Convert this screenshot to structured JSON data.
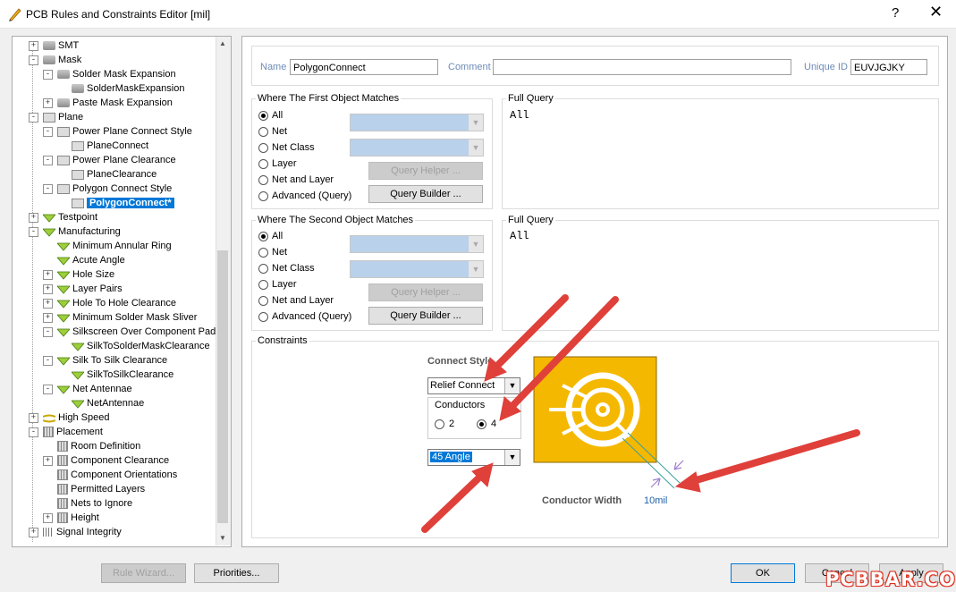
{
  "window": {
    "title": "PCB Rules and Constraints Editor [mil]",
    "help_label": "?",
    "close_label": "✕"
  },
  "tree": {
    "items": [
      {
        "label": "SMT",
        "level": 0,
        "exp": "+",
        "icon": "gray-rule-icon"
      },
      {
        "label": "Mask",
        "level": 0,
        "exp": "−",
        "icon": "gray-rule-icon"
      },
      {
        "label": "Solder Mask Expansion",
        "level": 1,
        "exp": "−",
        "icon": "gray-rule-icon"
      },
      {
        "label": "SolderMaskExpansion",
        "level": 2,
        "exp": "",
        "icon": "gray-rule-icon"
      },
      {
        "label": "Paste Mask Expansion",
        "level": 1,
        "exp": "+",
        "icon": "gray-rule-icon"
      },
      {
        "label": "Plane",
        "level": 0,
        "exp": "−",
        "icon": "plane-icon"
      },
      {
        "label": "Power Plane Connect Style",
        "level": 1,
        "exp": "−",
        "icon": "plane-icon"
      },
      {
        "label": "PlaneConnect",
        "level": 2,
        "exp": "",
        "icon": "plane-icon"
      },
      {
        "label": "Power Plane Clearance",
        "level": 1,
        "exp": "−",
        "icon": "plane-icon"
      },
      {
        "label": "PlaneClearance",
        "level": 2,
        "exp": "",
        "icon": "plane-icon"
      },
      {
        "label": "Polygon Connect Style",
        "level": 1,
        "exp": "−",
        "icon": "plane-icon"
      },
      {
        "label": "PolygonConnect*",
        "level": 2,
        "exp": "",
        "icon": "plane-icon",
        "selected": true
      },
      {
        "label": "Testpoint",
        "level": 0,
        "exp": "+",
        "icon": "testpoint-icon"
      },
      {
        "label": "Manufacturing",
        "level": 0,
        "exp": "−",
        "icon": "rule-icon"
      },
      {
        "label": "Minimum Annular Ring",
        "level": 1,
        "exp": "",
        "icon": "rule-icon"
      },
      {
        "label": "Acute Angle",
        "level": 1,
        "exp": "",
        "icon": "rule-icon"
      },
      {
        "label": "Hole Size",
        "level": 1,
        "exp": "+",
        "icon": "rule-icon"
      },
      {
        "label": "Layer Pairs",
        "level": 1,
        "exp": "+",
        "icon": "rule-icon"
      },
      {
        "label": "Hole To Hole Clearance",
        "level": 1,
        "exp": "+",
        "icon": "rule-icon"
      },
      {
        "label": "Minimum Solder Mask Sliver",
        "level": 1,
        "exp": "+",
        "icon": "rule-icon"
      },
      {
        "label": "Silkscreen Over Component Pads",
        "level": 1,
        "exp": "−",
        "icon": "rule-icon"
      },
      {
        "label": "SilkToSolderMaskClearance",
        "level": 2,
        "exp": "",
        "icon": "rule-icon"
      },
      {
        "label": "Silk To Silk Clearance",
        "level": 1,
        "exp": "−",
        "icon": "rule-icon"
      },
      {
        "label": "SilkToSilkClearance",
        "level": 2,
        "exp": "",
        "icon": "rule-icon"
      },
      {
        "label": "Net Antennae",
        "level": 1,
        "exp": "−",
        "icon": "rule-icon"
      },
      {
        "label": "NetAntennae",
        "level": 2,
        "exp": "",
        "icon": "rule-icon"
      },
      {
        "label": "High Speed",
        "level": 0,
        "exp": "+",
        "icon": "highspeed-icon"
      },
      {
        "label": "Placement",
        "level": 0,
        "exp": "−",
        "icon": "grid-icon"
      },
      {
        "label": "Room Definition",
        "level": 1,
        "exp": "",
        "icon": "grid-icon"
      },
      {
        "label": "Component Clearance",
        "level": 1,
        "exp": "+",
        "icon": "grid-icon"
      },
      {
        "label": "Component Orientations",
        "level": 1,
        "exp": "",
        "icon": "grid-icon"
      },
      {
        "label": "Permitted Layers",
        "level": 1,
        "exp": "",
        "icon": "grid-icon"
      },
      {
        "label": "Nets to Ignore",
        "level": 1,
        "exp": "",
        "icon": "grid-icon"
      },
      {
        "label": "Height",
        "level": 1,
        "exp": "+",
        "icon": "grid-icon"
      },
      {
        "label": "Signal Integrity",
        "level": 0,
        "exp": "+",
        "icon": "signal-icon"
      }
    ]
  },
  "rule": {
    "name_label": "Name",
    "name_value": "PolygonConnect",
    "comment_label": "Comment",
    "comment_value": "",
    "uid_label": "Unique ID",
    "uid_value": "EUVJGJKY"
  },
  "first": {
    "title": "Where The First Object Matches",
    "options": [
      "All",
      "Net",
      "Net Class",
      "Layer",
      "Net and Layer",
      "Advanced (Query)"
    ],
    "selected": "All",
    "query_helper": "Query Helper ...",
    "query_builder": "Query Builder ...",
    "full_query_title": "Full Query",
    "full_query": "All"
  },
  "second": {
    "title": "Where The Second Object Matches",
    "options": [
      "All",
      "Net",
      "Net Class",
      "Layer",
      "Net and Layer",
      "Advanced (Query)"
    ],
    "selected": "All",
    "query_helper": "Query Helper ...",
    "query_builder": "Query Builder ...",
    "full_query_title": "Full Query",
    "full_query": "All"
  },
  "constraints": {
    "title": "Constraints",
    "connect_style_label": "Connect Style",
    "connect_style_value": "Relief Connect",
    "conductors_label": "Conductors",
    "conductor_options": [
      "2",
      "4"
    ],
    "conductor_selected": "4",
    "angle_value": "45 Angle",
    "conductor_width_label": "Conductor Width",
    "conductor_width_value": "10mil",
    "pad_color": "#f5b800"
  },
  "footer": {
    "rule_wizard": "Rule Wizard...",
    "priorities": "Priorities...",
    "ok": "OK",
    "cancel": "Cancel",
    "apply": "Apply"
  },
  "watermark": "PCBBAR.COM",
  "colors": {
    "selection": "#0078d7",
    "arrow": "#e0403a"
  }
}
